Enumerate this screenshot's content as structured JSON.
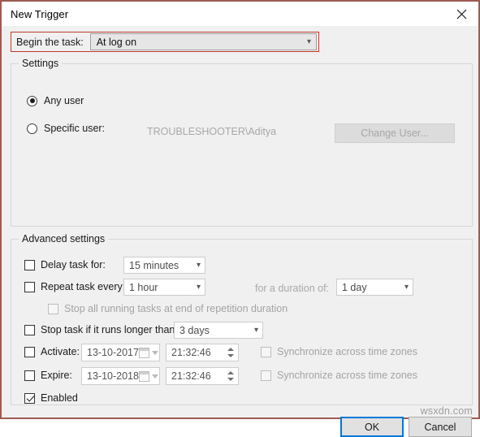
{
  "window": {
    "title": "New Trigger",
    "close_icon": "close-icon",
    "border_color": "#9c5b52",
    "highlight_color": "#c0392b"
  },
  "begin_task": {
    "label": "Begin the task:",
    "selected": "At log on",
    "chevron": "⌄"
  },
  "settings": {
    "legend": "Settings",
    "any_user": {
      "label": "Any user",
      "checked": true
    },
    "specific_user": {
      "label": "Specific user:",
      "checked": false
    },
    "user_value": "TROUBLESHOOTER\\Aditya",
    "change_user_button": "Change User...",
    "change_user_disabled": true
  },
  "advanced": {
    "legend": "Advanced settings",
    "delay_task": {
      "label": "Delay task for:",
      "checked": false,
      "value": "15 minutes"
    },
    "repeat_task": {
      "label": "Repeat task every:",
      "checked": false,
      "value": "1 hour"
    },
    "duration": {
      "label": "for a duration of:",
      "value": "1 day"
    },
    "stop_all_running": {
      "label": "Stop all running tasks at end of repetition duration",
      "checked": false,
      "disabled": true
    },
    "stop_task_longer": {
      "label": "Stop task if it runs longer than:",
      "checked": false,
      "value": "3 days"
    },
    "activate": {
      "label": "Activate:",
      "checked": false,
      "date": "13-10-2017",
      "time": "21:32:46",
      "sync_label": "Synchronize across time zones",
      "sync_checked": false
    },
    "expire": {
      "label": "Expire:",
      "checked": false,
      "date": "13-10-2018",
      "time": "21:32:46",
      "sync_label": "Synchronize across time zones",
      "sync_checked": false
    },
    "enabled": {
      "label": "Enabled",
      "checked": true
    }
  },
  "footer": {
    "ok": "OK",
    "cancel": "Cancel"
  },
  "watermark": "wsxdn.com"
}
